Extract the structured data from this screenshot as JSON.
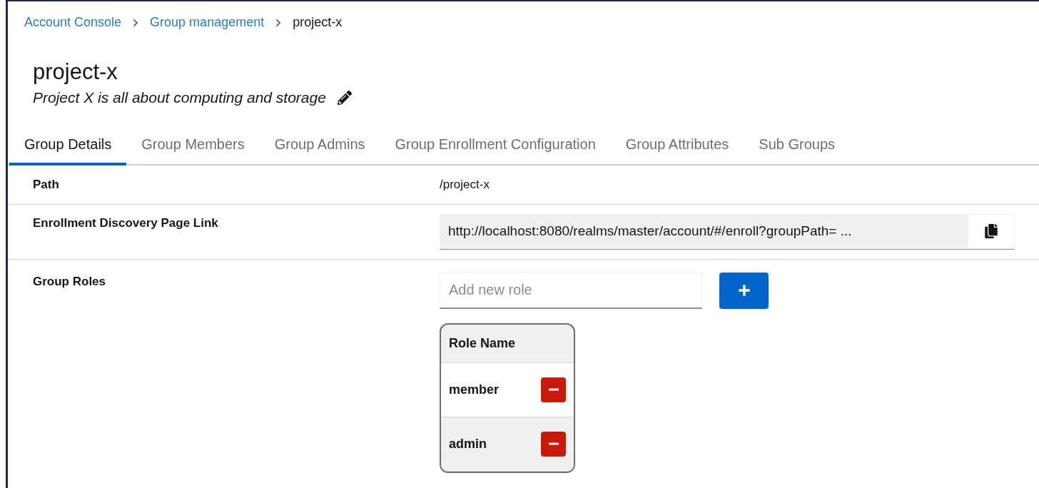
{
  "breadcrumbs": [
    {
      "label": "Account Console",
      "kind": "link"
    },
    {
      "label": "Group management",
      "kind": "link"
    },
    {
      "label": "project-x",
      "kind": "current"
    }
  ],
  "title": "project-x",
  "description": "Project X is all about computing and storage",
  "tabs": [
    {
      "label": "Group Details",
      "selected": true
    },
    {
      "label": "Group Members",
      "selected": false
    },
    {
      "label": "Group Admins",
      "selected": false
    },
    {
      "label": "Group Enrollment Configuration",
      "selected": false
    },
    {
      "label": "Group Attributes",
      "selected": false
    },
    {
      "label": "Sub Groups",
      "selected": false
    }
  ],
  "details": {
    "path": {
      "label": "Path",
      "value": "/project-x"
    },
    "link": {
      "label": "Enrollment Discovery Page Link",
      "value": "http://localhost:8080/realms/master/account/#/enroll?groupPath= ..."
    },
    "roles": {
      "label": "Group Roles",
      "placeholder": "Add new role",
      "column": "Role Name",
      "items": [
        "member",
        "admin"
      ]
    }
  }
}
